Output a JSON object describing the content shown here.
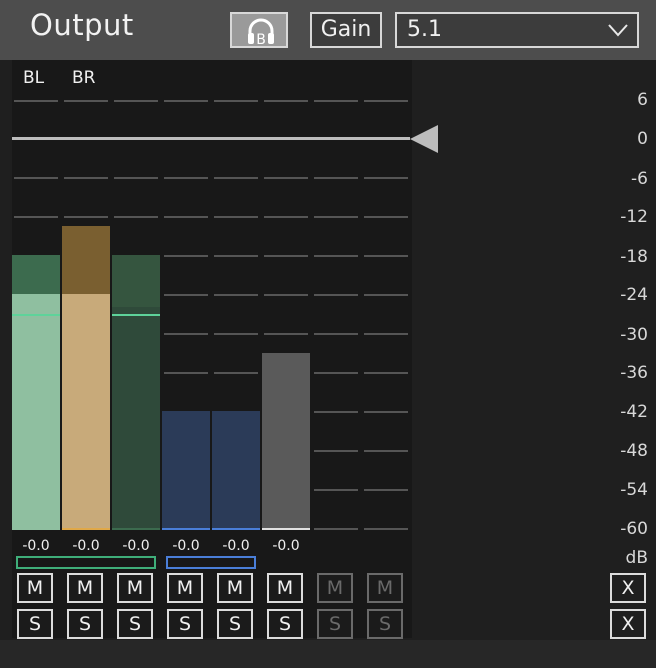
{
  "header": {
    "title": "Output",
    "headphone_button": {
      "icon": "headphones-b-icon",
      "letter": "B"
    },
    "gain_label": "Gain",
    "layout_select": {
      "value": "5.1"
    }
  },
  "channels": {
    "labels": [
      "BL",
      "BR"
    ],
    "peak_values": [
      "-0.0",
      "-0.0",
      "-0.0",
      "-0.0",
      "-0.0",
      "-0.0"
    ],
    "mute_labels": [
      "M",
      "M",
      "M",
      "M",
      "M",
      "M",
      "M",
      "M"
    ],
    "solo_labels": [
      "S",
      "S",
      "S",
      "S",
      "S",
      "S",
      "S",
      "S"
    ],
    "levels_db": [
      -24,
      -24,
      -26,
      -42,
      -42,
      -33
    ],
    "peak_hold_db": [
      -18,
      -13.5,
      -18,
      -42,
      -42,
      -33
    ],
    "colors": {
      "green_fill": "#8fbfa0",
      "green_peak": "#3c6b4e",
      "tan_fill": "#c8aa7a",
      "tan_peak": "#7a5f30",
      "darkgreen_fill": "#2f4a3a",
      "blue_fill": "#2b3b58",
      "gray_fill": "#5a5a5a",
      "link_green": "#3fae7a",
      "link_blue": "#4a7ed8"
    }
  },
  "scale": {
    "labels": [
      "6",
      "0",
      "-6",
      "-12",
      "-18",
      "-24",
      "-30",
      "-36",
      "-42",
      "-48",
      "-54",
      "-60"
    ],
    "unit": "dB",
    "range_db": [
      -60,
      6
    ]
  },
  "side_buttons": {
    "x1": "X",
    "x2": "X"
  }
}
